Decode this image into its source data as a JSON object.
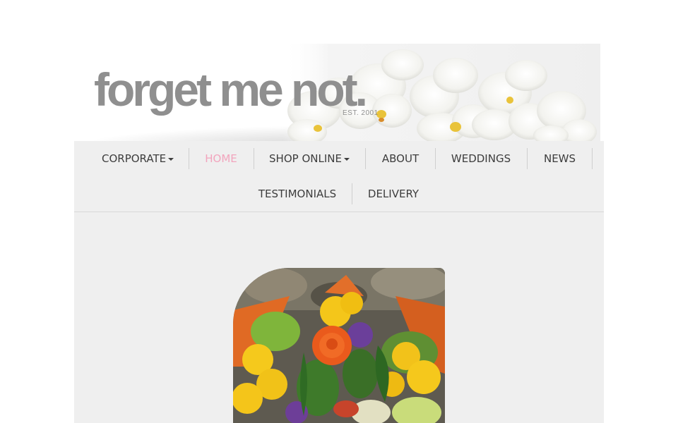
{
  "brand": {
    "name": "forget me not.",
    "established": "EST. 2001"
  },
  "nav": {
    "items": [
      {
        "label": "CORPORATE",
        "has_dropdown": true
      },
      {
        "label": "HOME",
        "active": true
      },
      {
        "label": "SHOP ONLINE",
        "has_dropdown": true
      },
      {
        "label": "ABOUT"
      },
      {
        "label": "WEDDINGS"
      },
      {
        "label": "NEWS"
      },
      {
        "label": "TESTIMONIALS"
      },
      {
        "label": "DELIVERY"
      }
    ]
  },
  "colors": {
    "active_nav": "#f2a5bd",
    "logo": "#8f8f8f",
    "panel_bg": "#efefef"
  },
  "icons": {
    "dropdown": "caret-down-icon",
    "header_art": "white-orchid-flowers",
    "hero": "flower-bouquet-photo"
  }
}
